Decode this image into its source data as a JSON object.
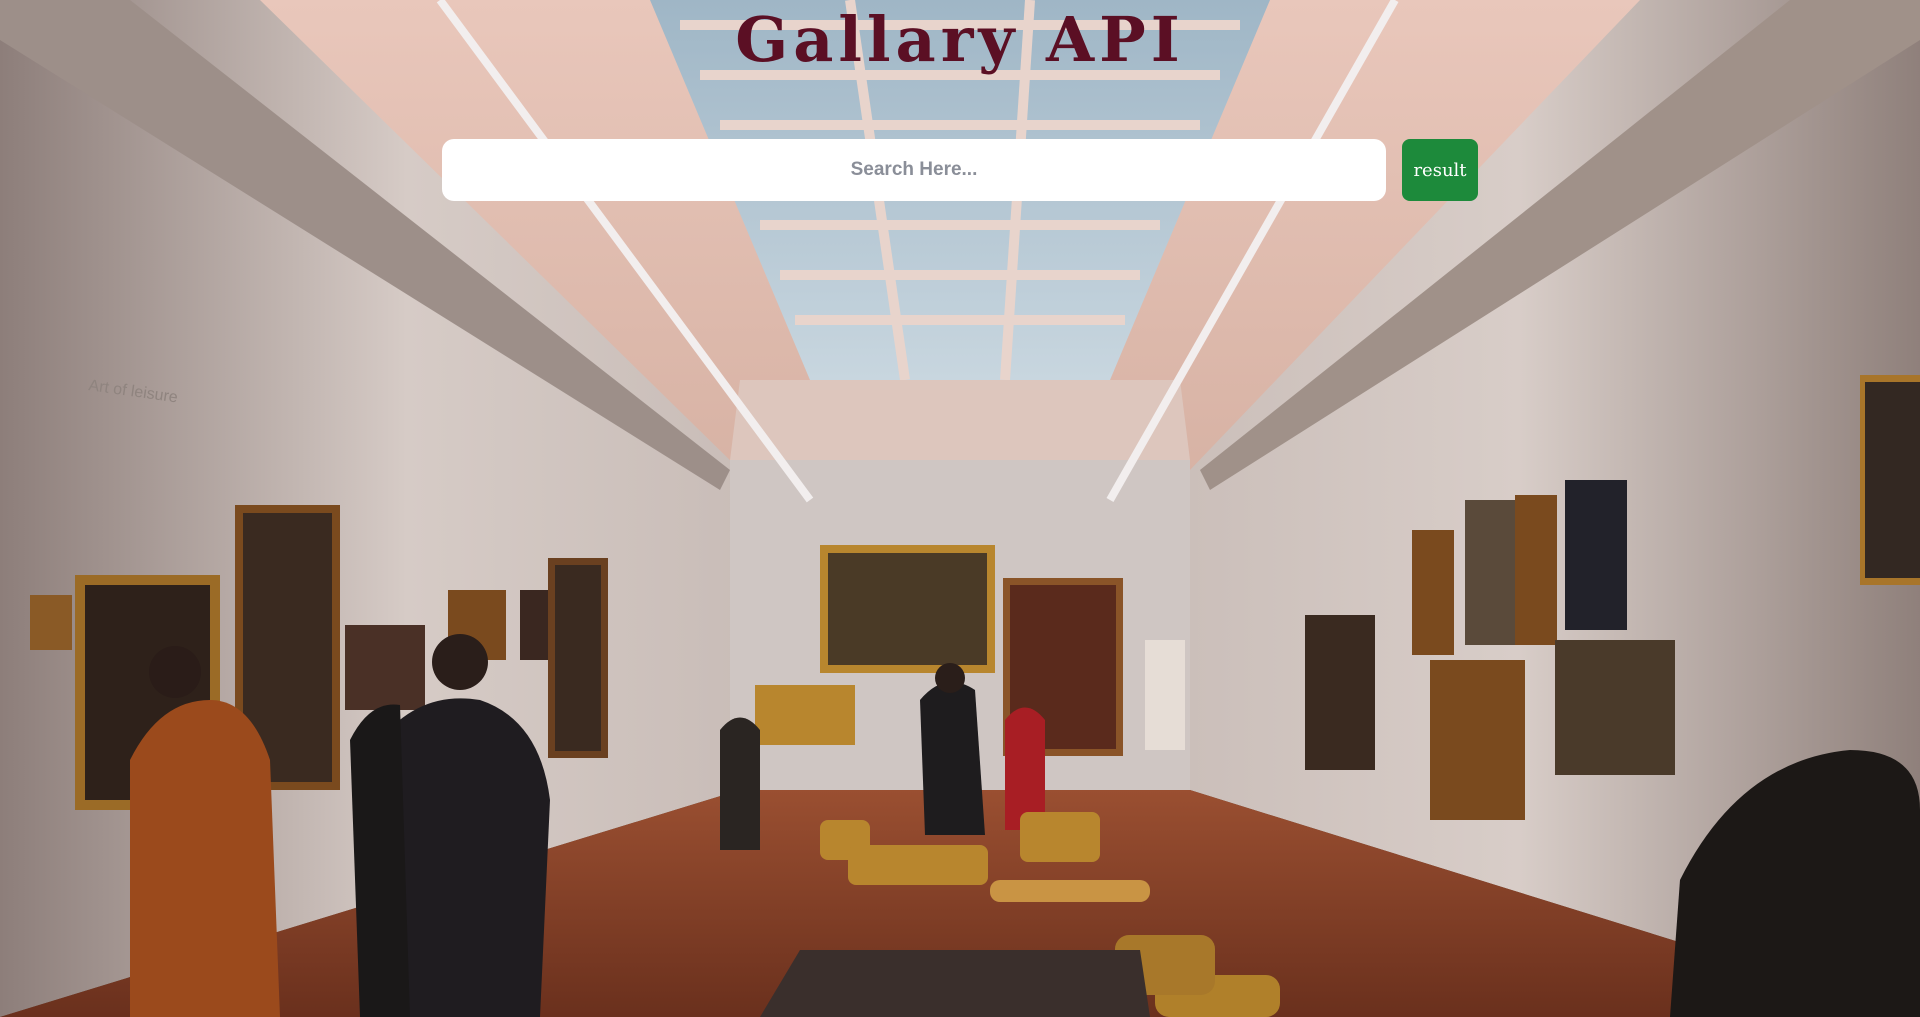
{
  "header": {
    "title": "Gallary API"
  },
  "search": {
    "placeholder": "Search Here...",
    "value": ""
  },
  "actions": {
    "result_label": "result"
  },
  "colors": {
    "title": "#5b0f24",
    "button": "#1d8a3b",
    "input_bg": "#ffffff",
    "placeholder": "#8a8e98"
  },
  "background": {
    "icon": "museum-gallery-photo",
    "wall_text_heading": "Art of leisure"
  }
}
